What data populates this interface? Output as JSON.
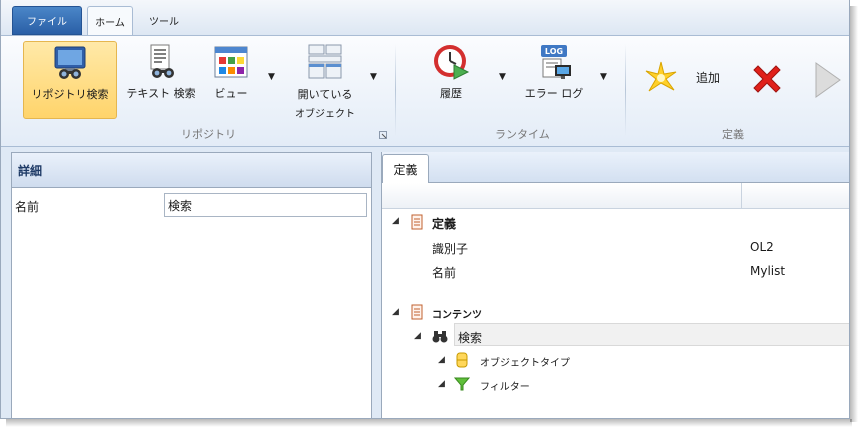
{
  "tabs": {
    "file": "ファイル",
    "home": "ホーム",
    "tools": "ツール"
  },
  "ribbon": {
    "repo_search": "リポジトリ検索",
    "text_search": "テキスト 検索",
    "view": "ビュー",
    "open_objects_line1": "開いている",
    "open_objects_line2": "オブジェクト",
    "history": "履歴",
    "error_log": "エラー ログ",
    "add": "追加",
    "group_repository": "リポジトリ",
    "group_runtime": "ランタイム",
    "group_definition": "定義",
    "log_badge": "LOG"
  },
  "details": {
    "header": "詳細",
    "name_label": "名前",
    "name_value": "検索"
  },
  "definition": {
    "tab": "定義",
    "section_title": "定義",
    "id_label": "識別子",
    "id_value": "OL2",
    "name_label": "名前",
    "name_value": "Mylist",
    "contents_title": "コンテンツ",
    "search_node": "検索",
    "object_type_node": "オブジェクトタイプ",
    "filter_node": "フィルター"
  },
  "colors": {
    "accent_blue": "#2a5fa6",
    "selected_button": "#ffd46b",
    "delete_red": "#e0201a",
    "add_star": "#ffd02a"
  }
}
